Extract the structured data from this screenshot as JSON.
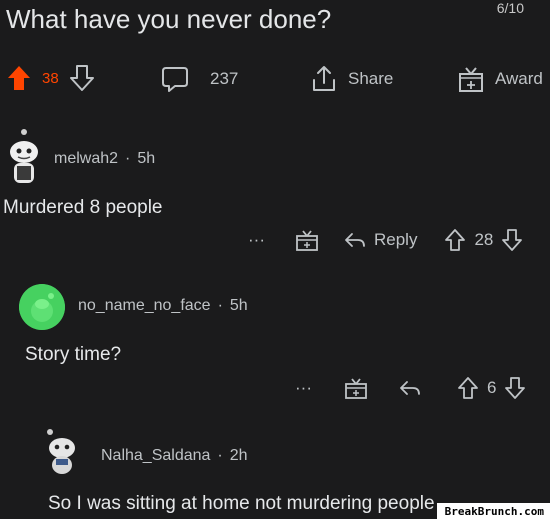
{
  "post": {
    "title": "What have you never done?",
    "page_counter": "6/10",
    "vote_count": "38",
    "comment_count": "237",
    "share_label": "Share",
    "award_label": "Award"
  },
  "comments": [
    {
      "username": "melwah2",
      "age": "5h",
      "body": "Murdered 8 people",
      "reply_label": "Reply",
      "votes": "28",
      "dots": "···"
    },
    {
      "username": "no_name_no_face",
      "age": "5h",
      "body": "Story time?",
      "votes": "6",
      "dots": "···"
    },
    {
      "username": "Nalha_Saldana",
      "age": "2h",
      "body": "So I was sitting at home not murdering people"
    }
  ],
  "separator": "·",
  "watermark": "BreakBrunch.com",
  "colors": {
    "background": "#1b1b1c",
    "upvote": "#ff4500",
    "avatar_green": "#46d160"
  },
  "icons": [
    "upvote-icon",
    "downvote-icon",
    "comment-bubble-icon",
    "share-icon",
    "gift-icon",
    "reply-arrow-icon",
    "snoo-icon"
  ]
}
